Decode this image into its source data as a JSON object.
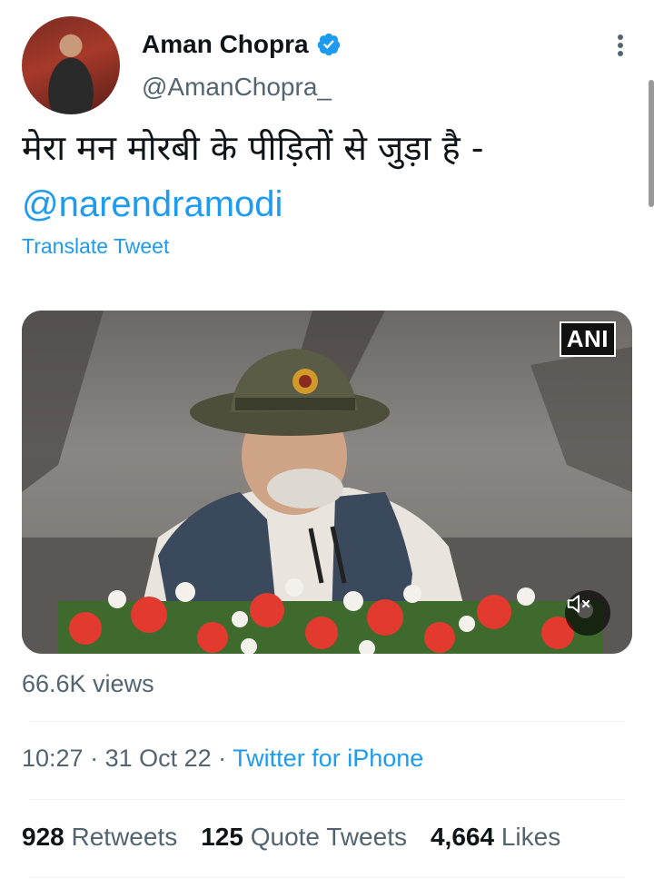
{
  "author": {
    "name": "Aman Chopra",
    "handle": "@AmanChopra_"
  },
  "tweet": {
    "text": "मेरा मन मोरबी के पीड़ितों से जुड़ा है -",
    "mention": "@narendramodi",
    "translate_label": "Translate Tweet"
  },
  "media": {
    "badge": "ANI"
  },
  "views": "66.6K views",
  "meta": {
    "time": "10:27",
    "sep1": " · ",
    "date": "31 Oct 22",
    "sep2": " · ",
    "source": "Twitter for iPhone"
  },
  "stats": {
    "retweets_count": "928",
    "retweets_label": "Retweets",
    "quotes_count": "125",
    "quotes_label": "Quote Tweets",
    "likes_count": "4,664",
    "likes_label": "Likes"
  },
  "colors": {
    "accent": "#1d9bf0",
    "text_primary": "#0f1419",
    "text_secondary": "#536471"
  },
  "icons": [
    "verified-badge-icon",
    "more-options-icon",
    "mute-icon"
  ]
}
